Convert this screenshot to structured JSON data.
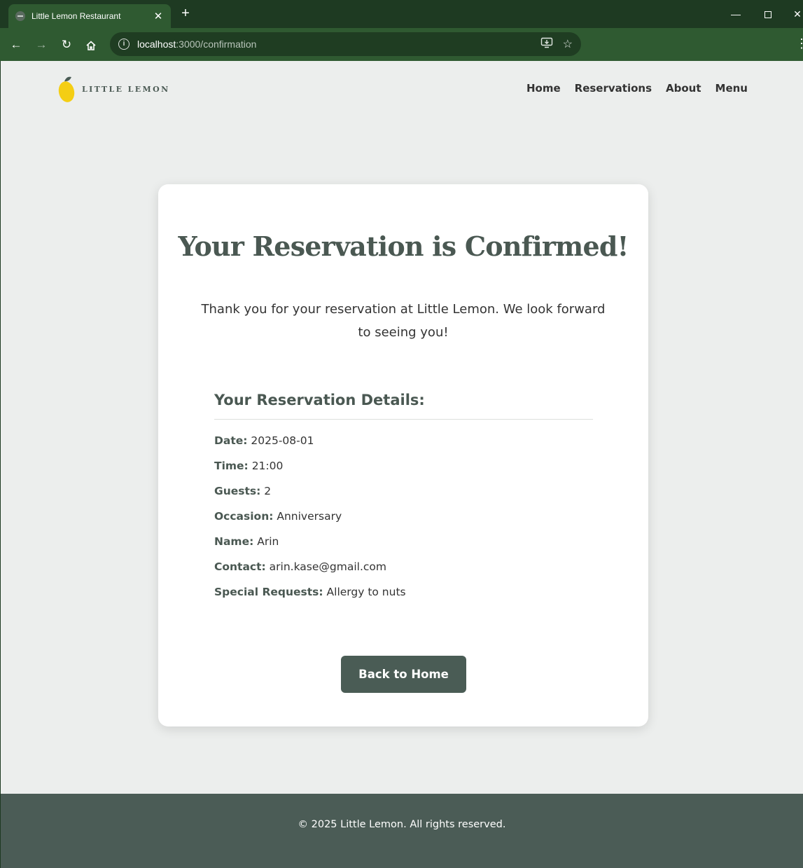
{
  "browser": {
    "tab_title": "Little Lemon Restaurant",
    "tab_close": "✕",
    "new_tab": "+",
    "url_host": "localhost",
    "url_path": ":3000/confirmation"
  },
  "site": {
    "logo_text": "LITTLE LEMON",
    "nav": [
      "Home",
      "Reservations",
      "About",
      "Menu"
    ]
  },
  "confirmation": {
    "title": "Your Reservation is Confirmed!",
    "message": "Thank you for your reservation at Little Lemon. We look forward to seeing you!",
    "details_heading": "Your Reservation Details:",
    "details": [
      {
        "label": "Date:",
        "value": "2025-08-01"
      },
      {
        "label": "Time:",
        "value": "21:00"
      },
      {
        "label": "Guests:",
        "value": "2"
      },
      {
        "label": "Occasion:",
        "value": "Anniversary"
      },
      {
        "label": "Name:",
        "value": "Arin"
      },
      {
        "label": "Contact:",
        "value": "arin.kase@gmail.com"
      },
      {
        "label": "Special Requests:",
        "value": "Allergy to nuts"
      }
    ],
    "back_button": "Back to Home"
  },
  "footer": {
    "text": "© 2025 Little Lemon. All rights reserved."
  },
  "colors": {
    "brand_green": "#4a5c55",
    "chrome_dark": "#1e3a22",
    "chrome_toolbar": "#2f5a31",
    "lemon_yellow": "#f4ce14"
  }
}
